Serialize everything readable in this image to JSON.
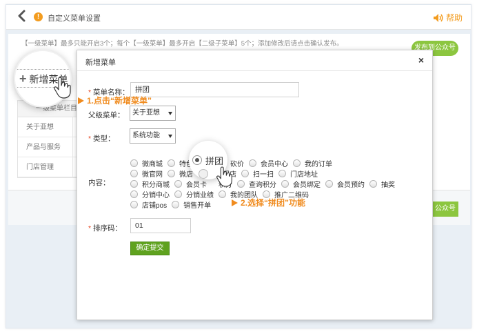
{
  "header": {
    "title": "自定义菜单设置",
    "help_label": "帮助"
  },
  "background": {
    "notice": "【一级菜单】最多只能开启3个；每个【一级菜单】最多开启【二级子菜单】5个；添加修改后请点击确认发布。",
    "publish_label": "发布到公众号",
    "publish_label_2": "公众号",
    "table_header": "一级菜单栏目",
    "menu_items": [
      "关于亚想",
      "产品与服务",
      "门店管理"
    ]
  },
  "magnifier": {
    "add_label": "新增菜单",
    "option_label": "拼团"
  },
  "modal": {
    "title": "新增菜单",
    "close_glyph": "×",
    "name_label": "菜单名称：",
    "name_value": "拼团",
    "parent_label": "父级菜单：",
    "parent_value": "关于亚想",
    "type_label": "类型：",
    "type_value": "系统功能",
    "content_label": "内容：",
    "sort_label": "排序码：",
    "sort_value": "01",
    "submit_label": "确定提交",
    "content_rows": [
      [
        "微商城",
        "特色",
        "拼团",
        "砍价",
        "会员中心",
        "我的订单"
      ],
      [
        "微官网",
        "微店",
        "",
        "门店",
        "扫一扫",
        "门店地址"
      ],
      [
        "积分商城",
        "会员卡",
        "",
        "积分",
        "查询积分",
        "会员绑定",
        "会员预约",
        "抽奖"
      ],
      [
        "分销中心",
        "分销业绩",
        "我的团队",
        "推广二维码"
      ],
      [
        "店铺pos",
        "销售开单"
      ]
    ],
    "selected_option": "拼团"
  },
  "annotations": {
    "step1": "1.点击“新增菜单”",
    "step2": "2.选择“拼团”功能"
  },
  "colors": {
    "accent_green": "#8cc63f",
    "annotation_orange": "#f08b1e",
    "submit_green": "#5fa21f"
  }
}
